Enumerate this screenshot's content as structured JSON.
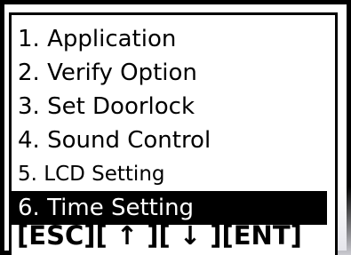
{
  "menu": {
    "items": [
      {
        "label": "1. Application"
      },
      {
        "label": "2. Verify Option"
      },
      {
        "label": "3. Set Doorlock"
      },
      {
        "label": "4. Sound Control"
      },
      {
        "label": "5. LCD Setting"
      },
      {
        "label": "6. Time Setting"
      }
    ],
    "selected_index": 6
  },
  "footer": {
    "key_hints": "[ESC][ ↑ ][ ↓ ][ENT]"
  },
  "colors": {
    "background": "#ffffff",
    "text": "#000000",
    "highlight_bg": "#000000",
    "highlight_text": "#ffffff"
  }
}
